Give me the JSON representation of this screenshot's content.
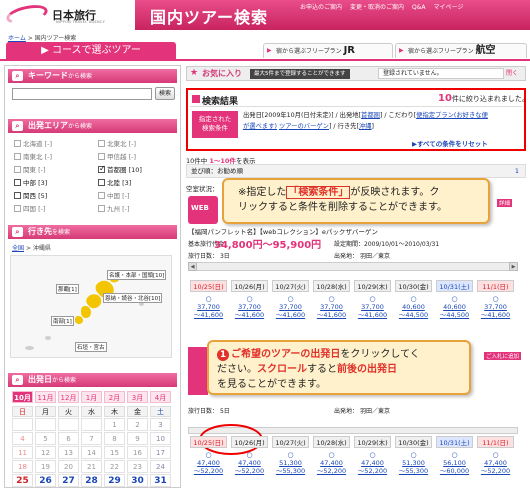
{
  "header": {
    "logo_name": "日本旅行",
    "logo_sub": "NIPPON TRAVEL AGENCY",
    "page_title": "国内ツアー検索",
    "top_links": [
      "お申込のご案内",
      "変更・取消のご案内",
      "Q&A",
      "マイページ"
    ]
  },
  "breadcrumb": {
    "home": "ホーム",
    "sep": " > ",
    "current": "国内ツアー検索"
  },
  "tabs": {
    "course": "コースで選ぶツアー",
    "jr_prefix": "宿から選ぶフリープラン",
    "jr": "JR",
    "air_prefix": "宿から選ぶフリープラン",
    "air": "航空"
  },
  "sidebar": {
    "keyword_head": "キーワード",
    "keyword_head_small": "から検索",
    "search_button": "検索",
    "area_head": "出発エリア",
    "area_head_small": "から検索",
    "areas": [
      {
        "label": "北海道 [-]",
        "checked": false,
        "active": false
      },
      {
        "label": "北東北 [-]",
        "checked": false,
        "active": false
      },
      {
        "label": "南東北 [-]",
        "checked": false,
        "active": false
      },
      {
        "label": "甲信越 [-]",
        "checked": false,
        "active": false
      },
      {
        "label": "関東 [-]",
        "checked": false,
        "active": false
      },
      {
        "label": "首都圏 [10]",
        "checked": true,
        "active": true
      },
      {
        "label": "中部 [3]",
        "checked": false,
        "active": true
      },
      {
        "label": "北陸 [3]",
        "checked": false,
        "active": true
      },
      {
        "label": "関西 [5]",
        "checked": false,
        "active": true
      },
      {
        "label": "中国 [-]",
        "checked": false,
        "active": false
      },
      {
        "label": "四国 [-]",
        "checked": false,
        "active": false
      },
      {
        "label": "九州 [-]",
        "checked": false,
        "active": false
      }
    ],
    "dest_head": "行き先",
    "dest_head_small": "を検索",
    "map_crumb_link": "全国",
    "map_crumb_rest": " > 沖縄県",
    "map_labels": [
      "名護・本部・国頭[10]",
      "那覇[1]",
      "恩納・読谷・北谷[10]",
      "南部[1]",
      "石垣・宮古"
    ],
    "cal_head": "出発日",
    "cal_head_small": "から検索",
    "cal_months": [
      "10月",
      "11月",
      "12月",
      "1月",
      "2月",
      "3月",
      "4月"
    ],
    "cal_weekdays": [
      "日",
      "月",
      "火",
      "水",
      "木",
      "金",
      "土"
    ],
    "cal_rows": [
      [
        "",
        "",
        "",
        "",
        "1",
        "2",
        "3"
      ],
      [
        "4",
        "5",
        "6",
        "7",
        "8",
        "9",
        "10"
      ],
      [
        "11",
        "12",
        "13",
        "14",
        "15",
        "16",
        "17"
      ],
      [
        "18",
        "19",
        "20",
        "21",
        "22",
        "23",
        "24"
      ],
      [
        "25",
        "26",
        "27",
        "28",
        "29",
        "30",
        "31"
      ]
    ]
  },
  "favorites": {
    "title": "お気に入り",
    "note": "最大5件まで登録することができます",
    "empty": "登録されていません。",
    "close": "閉く"
  },
  "results": {
    "title": "検索結果",
    "count": "10",
    "count_suffix": "件に絞り込まれました。",
    "cond_label_1": "指定された",
    "cond_label_2": "検索条件",
    "cond_line1_a": "出発日[2009年10月(日付未定)] / 出発地[",
    "cond_line1_link": "首都圏",
    "cond_line1_b": "] / こだわり[",
    "cond_line1_link2": "便指定プラン(お好きな便",
    "cond_line2_link": "が選べます)",
    "cond_line2_b": " ",
    "cond_line2_link2": "ツアーのバーゲン",
    "cond_line2_c": "] / 行き先[",
    "cond_line2_link3": "沖縄",
    "cond_line2_d": "]",
    "reset": "▶すべての条件をリセット",
    "pager": "10件中",
    "pager_range": "1〜10件",
    "pager_suffix": "を表示",
    "sort_label": "並び順：",
    "sort_value": "お勧め順",
    "page_number": "1",
    "vacancy": "空室状況："
  },
  "callout1": {
    "pre": "※指定した",
    "highlight": "「検索条件」",
    "post": "が反映されます。ク",
    "line2": "リックすると条件を削除することができます。"
  },
  "tour1": {
    "name": "【福岡パンフレット名】【webコレクション】eパックザバーゲン",
    "price_label": "基本旅行代金",
    "price": "34,800円〜95,900円",
    "period_label": "設定期間：",
    "period": "2009/10/01〜2010/03/31",
    "days_label": "旅行日数：",
    "days": "3日",
    "dep_label": "出発地：",
    "dep": "羽田／東京",
    "badge": "詳細"
  },
  "tour1_dates": [
    {
      "date": "10/25(日)",
      "kind": "sun",
      "price1": "37,700",
      "price2": "〜41,600"
    },
    {
      "date": "10/26(月)",
      "kind": "",
      "price1": "37,700",
      "price2": "〜41,600"
    },
    {
      "date": "10/27(火)",
      "kind": "",
      "price1": "37,700",
      "price2": "〜41,600"
    },
    {
      "date": "10/28(水)",
      "kind": "",
      "price1": "37,700",
      "price2": "〜41,600"
    },
    {
      "date": "10/29(木)",
      "kind": "",
      "price1": "37,700",
      "price2": "〜41,600"
    },
    {
      "date": "10/30(金)",
      "kind": "",
      "price1": "40,600",
      "price2": "〜44,500"
    },
    {
      "date": "10/31(土)",
      "kind": "sat",
      "price1": "40,600",
      "price2": "〜44,500"
    },
    {
      "date": "11/1(日)",
      "kind": "sun",
      "price1": "37,700",
      "price2": "〜41,600"
    }
  ],
  "callout2": {
    "num": "1",
    "a": "ご希望のツアーの",
    "b": "出発日",
    "c": "をクリックしてく",
    "d": "ださい。",
    "e": "スクロール",
    "f": "すると",
    "g": "前後の出発日",
    "h": "を見ることができます。"
  },
  "tour2": {
    "days_label": "旅行日数：",
    "days": "5日",
    "dep_label": "出発地：",
    "dep": "羽田／東京",
    "badge": "ご入札に追加"
  },
  "tour2_dates": [
    {
      "date": "10/25(日)",
      "kind": "sun",
      "price1": "47,400",
      "price2": "〜52,200"
    },
    {
      "date": "10/26(月)",
      "kind": "",
      "price1": "47,400",
      "price2": "〜52,200"
    },
    {
      "date": "10/27(火)",
      "kind": "",
      "price1": "51,300",
      "price2": "〜55,300"
    },
    {
      "date": "10/28(水)",
      "kind": "",
      "price1": "47,400",
      "price2": "〜52,200"
    },
    {
      "date": "10/29(木)",
      "kind": "",
      "price1": "47,400",
      "price2": "〜52,200"
    },
    {
      "date": "10/30(金)",
      "kind": "",
      "price1": "51,300",
      "price2": "〜55,300"
    },
    {
      "date": "10/31(土)",
      "kind": "sat",
      "price1": "56,100",
      "price2": "〜60,000"
    },
    {
      "date": "11/1(日)",
      "kind": "sun",
      "price1": "47,400",
      "price2": "〜52,200"
    }
  ],
  "colors": {
    "brand": "#e3337a",
    "link": "#1a47b8",
    "alert": "#e00000"
  },
  "icons": [
    "search-icon",
    "star-icon",
    "pin-icon",
    "calendar-icon",
    "circle-icon"
  ]
}
